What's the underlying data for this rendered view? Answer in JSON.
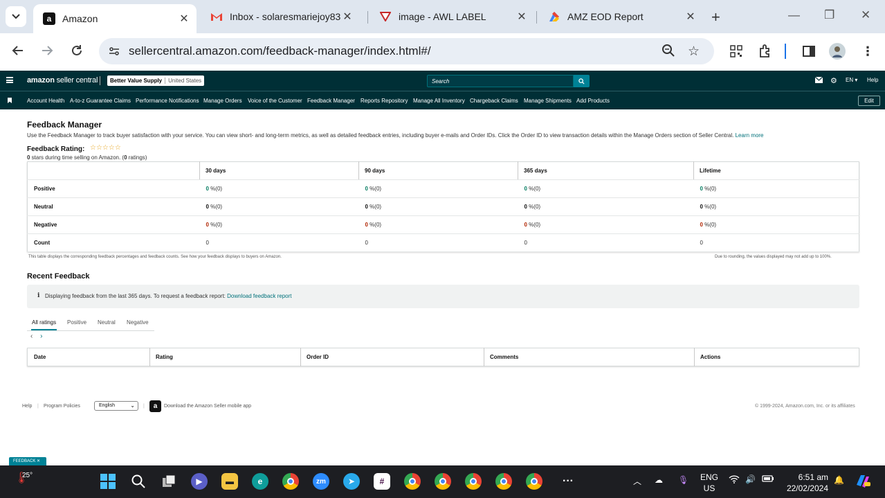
{
  "browser": {
    "tabs": [
      {
        "title": "Amazon",
        "active": true
      },
      {
        "title": "Inbox - solaresmariejoy83",
        "active": false
      },
      {
        "title": "image - AWL LABEL",
        "active": false
      },
      {
        "title": "AMZ EOD Report",
        "active": false
      }
    ],
    "url": "sellercentral.amazon.com/feedback-manager/index.html#/",
    "icons": [
      "back-icon",
      "forward-icon",
      "reload-icon",
      "site-info-icon",
      "zoom-icon",
      "star-icon",
      "qr-icon",
      "extensions-icon",
      "sidepanel-icon",
      "profile-avatar",
      "menu-icon"
    ]
  },
  "seller_header": {
    "logo_bold": "amazon",
    "logo_rest": "seller central",
    "store_name": "Better Value Supply",
    "marketplace": "United States",
    "search_placeholder": "Search",
    "language": "EN",
    "help": "Help",
    "edit": "Edit"
  },
  "nav_items": [
    "Account Health",
    "A-to-z Guarantee Claims",
    "Performance Notifications",
    "Manage Orders",
    "Voice of the Customer",
    "Feedback Manager",
    "Reports Repository",
    "Manage All Inventory",
    "Chargeback Claims",
    "Manage Shipments",
    "Add Products"
  ],
  "page": {
    "title": "Feedback Manager",
    "description": "Use the Feedback Manager to track buyer satisfaction with your service. You can view short- and long-term metrics, as well as detailed feedback entries, including buyer e-mails and Order IDs. Click the Order ID to view transaction details within the Manage Orders section of Seller Central.",
    "learn_more": "Learn more",
    "rating_label": "Feedback Rating:",
    "stars": "☆☆☆☆☆",
    "rating_stars_count": "0",
    "rating_sub_mid": " stars during time selling on Amazon. (",
    "rating_count": "0",
    "rating_sub_end": " ratings)",
    "table": {
      "headers": [
        "",
        "30 days",
        "90 days",
        "365 days",
        "Lifetime"
      ],
      "rows": [
        {
          "label": "Positive",
          "values": [
            {
              "num": "0",
              "rest": " %(0)"
            },
            {
              "num": "0",
              "rest": " %(0)"
            },
            {
              "num": "0",
              "rest": " %(0)"
            },
            {
              "num": "0",
              "rest": " %(0)"
            }
          ]
        },
        {
          "label": "Neutral",
          "values": [
            {
              "num": "0",
              "rest": " %(0)"
            },
            {
              "num": "0",
              "rest": " %(0)"
            },
            {
              "num": "0",
              "rest": " %(0)"
            },
            {
              "num": "0",
              "rest": " %(0)"
            }
          ]
        },
        {
          "label": "Negative",
          "values": [
            {
              "num": "0",
              "rest": " %(0)"
            },
            {
              "num": "0",
              "rest": " %(0)"
            },
            {
              "num": "0",
              "rest": " %(0)"
            },
            {
              "num": "0",
              "rest": " %(0)"
            }
          ]
        },
        {
          "label": "Count",
          "values": [
            {
              "num": "",
              "rest": "0"
            },
            {
              "num": "",
              "rest": "0"
            },
            {
              "num": "",
              "rest": "0"
            },
            {
              "num": "",
              "rest": "0"
            }
          ]
        }
      ],
      "note_left": "This table displays the corresponding feedback percentages and feedback counts. See how your feedback displays to buyers on Amazon.",
      "note_right": "Due to rounding, the values displayed may not add up to 100%."
    },
    "recent_title": "Recent Feedback",
    "info_icon": "i",
    "info_text": "Displaying feedback from the last 365 days. To request a feedback report: ",
    "info_link": "Download feedback report",
    "filter_tabs": [
      "All ratings",
      "Positive",
      "Neutral",
      "Negative"
    ],
    "pager_prev": "‹",
    "pager_next": "›",
    "recent_headers": [
      "Date",
      "Rating",
      "Order ID",
      "Comments",
      "Actions"
    ]
  },
  "footer": {
    "help": "Help",
    "program_policies": "Program Policies",
    "language": "English",
    "app_icon": "a",
    "app_text": "Download the Amazon Seller mobile app",
    "copyright": "© 1999-2024, Amazon.com, Inc. or its affiliates"
  },
  "feedback_chip": "FEEDBACK ✕",
  "taskbar": {
    "weather": "25°",
    "tray_lang_1": "ENG",
    "tray_lang_2": "US",
    "time": "6:51 am",
    "date": "22/02/2024",
    "apps": [
      "start-icon",
      "search-icon",
      "task-view-icon",
      "teams-icon",
      "file-explorer-icon",
      "edge-icon",
      "chrome-icon",
      "zoom-icon",
      "telegram-icon",
      "slack-icon",
      "chrome-profile-1-icon",
      "chrome-profile-2-icon",
      "chrome-profile-3-icon",
      "chrome-profile-4-icon",
      "chrome-profile-5-icon",
      "more-icon"
    ]
  }
}
